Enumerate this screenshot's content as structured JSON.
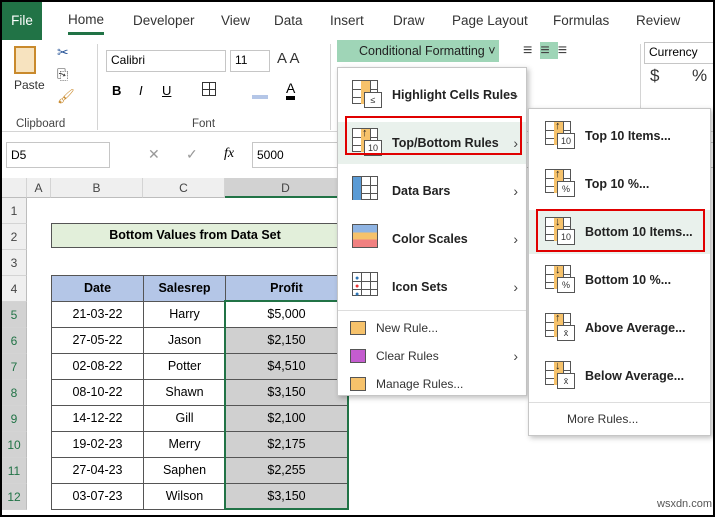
{
  "tabs": [
    "File",
    "Home",
    "Developer",
    "View",
    "Data",
    "Insert",
    "Draw",
    "Page Layout",
    "Formulas",
    "Review"
  ],
  "ribbon": {
    "paste": "Paste",
    "clipboard": "Clipboard",
    "font_name": "Calibri",
    "font_size": "11",
    "font": "Font",
    "bold": "B",
    "italic": "I",
    "underline": "U",
    "cf_button": "Conditional Formatting",
    "number_format": "Currency",
    "dollar": "$",
    "percent": "%"
  },
  "formula_bar": {
    "name_box": "D5",
    "fx": "fx",
    "value": "5000"
  },
  "columns": [
    "A",
    "B",
    "C",
    "D"
  ],
  "rows": [
    "1",
    "2",
    "3",
    "4",
    "5",
    "6",
    "7",
    "8",
    "9",
    "10",
    "11",
    "12"
  ],
  "sheet": {
    "title": "Bottom  Values from Data Set",
    "headers": [
      "Date",
      "Salesrep",
      "Profit"
    ],
    "data": [
      [
        "21-03-22",
        "Harry",
        "$5,000"
      ],
      [
        "27-05-22",
        "Jason",
        "$2,150"
      ],
      [
        "02-08-22",
        "Potter",
        "$4,510"
      ],
      [
        "08-10-22",
        "Shawn",
        "$3,150"
      ],
      [
        "14-12-22",
        "Gill",
        "$2,100"
      ],
      [
        "19-02-23",
        "Merry",
        "$2,175"
      ],
      [
        "27-04-23",
        "Saphen",
        "$2,255"
      ],
      [
        "03-07-23",
        "Wilson",
        "$3,150"
      ]
    ]
  },
  "menu": {
    "items": [
      "Highlight Cells Rules",
      "Top/Bottom Rules",
      "Data Bars",
      "Color Scales",
      "Icon Sets"
    ],
    "small_items": [
      "New Rule...",
      "Clear Rules",
      "Manage Rules..."
    ]
  },
  "submenu": {
    "items": [
      {
        "label": "Top 10 Items...",
        "badge": "10",
        "arrow": "↑"
      },
      {
        "label": "Top 10 %...",
        "badge": "%",
        "arrow": "↑"
      },
      {
        "label": "Bottom 10 Items...",
        "badge": "10",
        "arrow": "↓"
      },
      {
        "label": "Bottom 10 %...",
        "badge": "%",
        "arrow": "↓"
      },
      {
        "label": "Above Average...",
        "badge": "x̄",
        "arrow": "↑"
      },
      {
        "label": "Below Average...",
        "badge": "x̄",
        "arrow": "↓"
      }
    ],
    "more": "More Rules..."
  },
  "watermark": "wsxdn.com"
}
